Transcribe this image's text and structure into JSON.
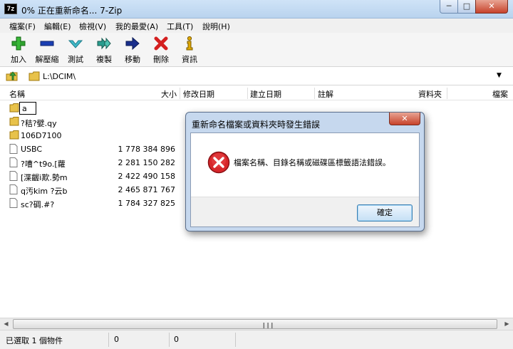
{
  "window": {
    "app_icon": "7z",
    "title": "0% 正在重新命名... 7-Zip",
    "minimize_icon": "minimize-icon",
    "maximize_icon": "maximize-icon",
    "close_icon": "close-icon"
  },
  "menu": [
    "檔案(F)",
    "編輯(E)",
    "檢視(V)",
    "我的最愛(A)",
    "工具(T)",
    "說明(H)"
  ],
  "toolbar": [
    {
      "label": "加入",
      "icon": "plus-icon",
      "color": "#2fa32f"
    },
    {
      "label": "解壓縮",
      "icon": "minus-icon",
      "color": "#1b3fb3"
    },
    {
      "label": "測試",
      "icon": "check-icon",
      "color": "#3fb8c8"
    },
    {
      "label": "複製",
      "icon": "double-arrow-icon",
      "color": "#2a9d8f"
    },
    {
      "label": "移動",
      "icon": "arrow-right-icon",
      "color": "#1a2f8c"
    },
    {
      "label": "刪除",
      "icon": "x-icon",
      "color": "#d42020"
    },
    {
      "label": "資訊",
      "icon": "info-icon",
      "color": "#e0a800"
    }
  ],
  "address": {
    "path": "L:\\DCIM\\"
  },
  "columns": {
    "name": "名稱",
    "size": "大小",
    "modified": "修改日期",
    "created": "建立日期",
    "comment": "註解",
    "folders": "資料夾",
    "files": "檔案"
  },
  "files": [
    {
      "type": "folder",
      "name": "a",
      "size": "",
      "editing": true
    },
    {
      "type": "folder",
      "name": "?秸?嬖.qy",
      "size": ""
    },
    {
      "type": "folder",
      "name": "106D7100",
      "size": ""
    },
    {
      "type": "file",
      "name": "USBC",
      "size": "1 778 384 896"
    },
    {
      "type": "file",
      "name": "?嘈^t9o.[蘿",
      "size": "2 281 150 282"
    },
    {
      "type": "file",
      "name": "[渫齷i欺.勢m",
      "size": "2 422 490 158"
    },
    {
      "type": "file",
      "name": "q汚kim  ?云b",
      "size": "2 465 871 767"
    },
    {
      "type": "file",
      "name": " sc?碉.#?",
      "size": "1 784 327 825"
    }
  ],
  "status": {
    "selection": "已選取 1 個物件",
    "cell2": "0",
    "cell3": "0"
  },
  "dialog": {
    "title": "重新命名檔案或資料夾時發生錯誤",
    "icon": "error-icon",
    "message": "檔案名稱、目錄名稱或磁碟區標籤語法錯誤。",
    "ok_label": "確定",
    "close_icon": "close-icon"
  }
}
